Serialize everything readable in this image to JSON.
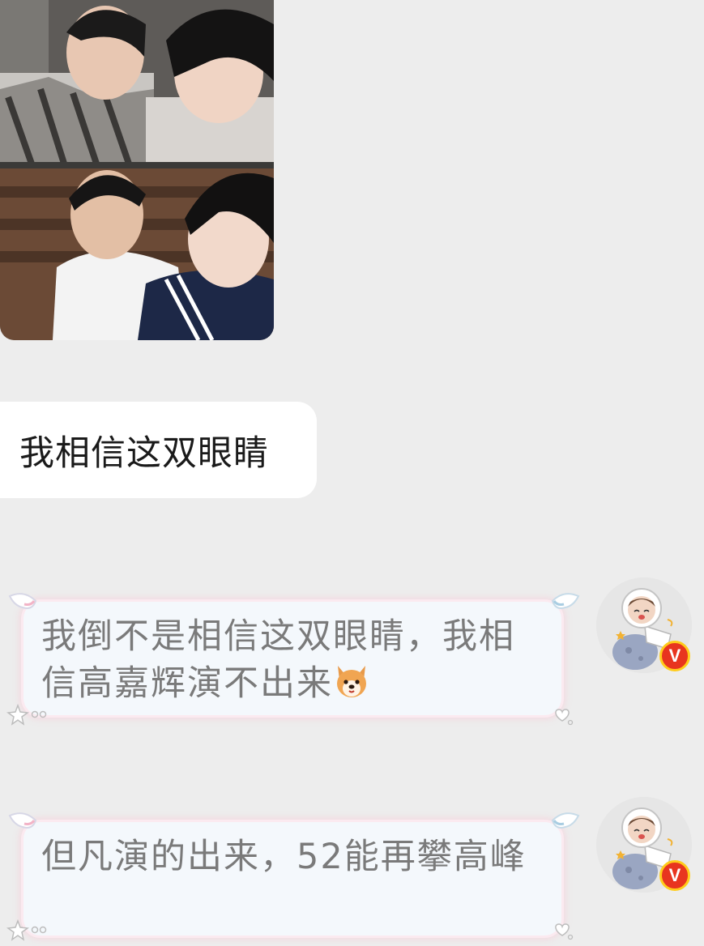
{
  "messages": [
    {
      "type": "image",
      "side": "left",
      "description_icon": "photo-collage"
    },
    {
      "type": "text",
      "side": "left",
      "text": "我相信这双眼睛"
    },
    {
      "type": "text",
      "side": "right",
      "text": "我倒不是相信这双眼睛，我相信高嘉辉演不出来",
      "emoji": "dog-face-icon",
      "badge": "V"
    },
    {
      "type": "text",
      "side": "right",
      "text": "但凡演的出来，52能再攀高峰",
      "badge": "V"
    }
  ],
  "colors": {
    "background": "#ededed",
    "left_bubble": "#ffffff",
    "right_bubble": "#f4f8fc",
    "right_text": "#7a7a7a",
    "badge": "#e8351f",
    "badge_ring": "#ffcc1a"
  }
}
